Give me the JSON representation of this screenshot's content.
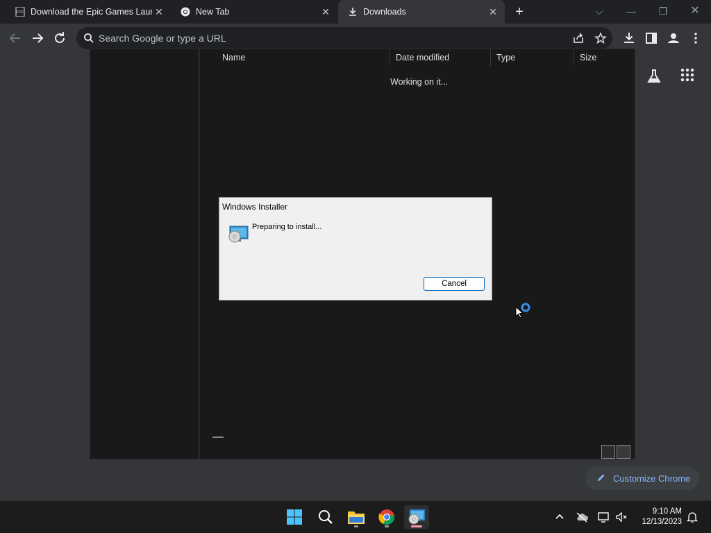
{
  "tabs": [
    {
      "title": "Download the Epic Games Launc",
      "favicon": "epic-icon",
      "close": "✕"
    },
    {
      "title": "New Tab",
      "favicon": "chrome-icon",
      "close": "✕"
    },
    {
      "title": "Downloads",
      "favicon": "download-icon",
      "close": "✕"
    }
  ],
  "new_tab": "+",
  "window_controls": {
    "menu": "⌵",
    "minimize": "—",
    "restore": "❐",
    "close": "✕"
  },
  "toolbar": {
    "search_placeholder": "Search Google or type a URL",
    "icons": [
      "back-icon",
      "forward-icon",
      "reload-icon",
      "share-icon",
      "bookmark-star-icon",
      "downloads-icon",
      "side-panel-icon",
      "profile-icon",
      "menu-icon"
    ]
  },
  "explorer": {
    "columns": [
      "Name",
      "Date modified",
      "Type",
      "Size"
    ],
    "status": "Working on it..."
  },
  "dialog": {
    "title": "Windows Installer",
    "message": "Preparing to install...",
    "cancel_label": "Cancel"
  },
  "page": {
    "customize_label": "Customize Chrome"
  },
  "taskbar": {
    "apps": [
      "start-icon",
      "search-icon",
      "file-explorer-icon",
      "chrome-icon",
      "installer-icon"
    ],
    "time": "9:10 AM",
    "date": "12/13/2023"
  },
  "colors": {
    "accent": "#8ab4f8",
    "chrome_bg": "#202124",
    "toolbar": "#35363a"
  }
}
